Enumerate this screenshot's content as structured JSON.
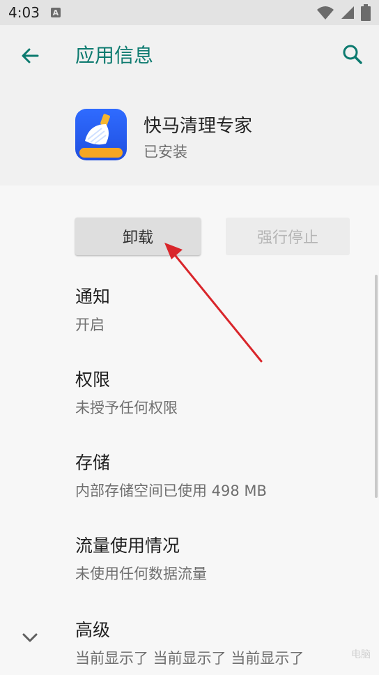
{
  "status_bar": {
    "time": "4:03",
    "notification_letter": "A"
  },
  "app_bar": {
    "title": "应用信息",
    "back_icon": "arrow-back-icon",
    "search_icon": "search-icon"
  },
  "app": {
    "name": "快马清理专家",
    "status": "已安装",
    "icon_label": "一键清理"
  },
  "actions": {
    "uninstall_label": "卸载",
    "force_stop_label": "强行停止"
  },
  "items": [
    {
      "title": "通知",
      "subtitle": "开启"
    },
    {
      "title": "权限",
      "subtitle": "未授予任何权限"
    },
    {
      "title": "存储",
      "subtitle": "内部存储空间已使用 498 MB"
    },
    {
      "title": "流量使用情况",
      "subtitle": "未使用任何数据流量"
    },
    {
      "title": "高级",
      "subtitle": "当前显示了 当前显示了 当前显示了"
    }
  ],
  "colors": {
    "accent": "#0c7a6f",
    "annotation_arrow": "#d9262b"
  },
  "watermark": "电脑"
}
